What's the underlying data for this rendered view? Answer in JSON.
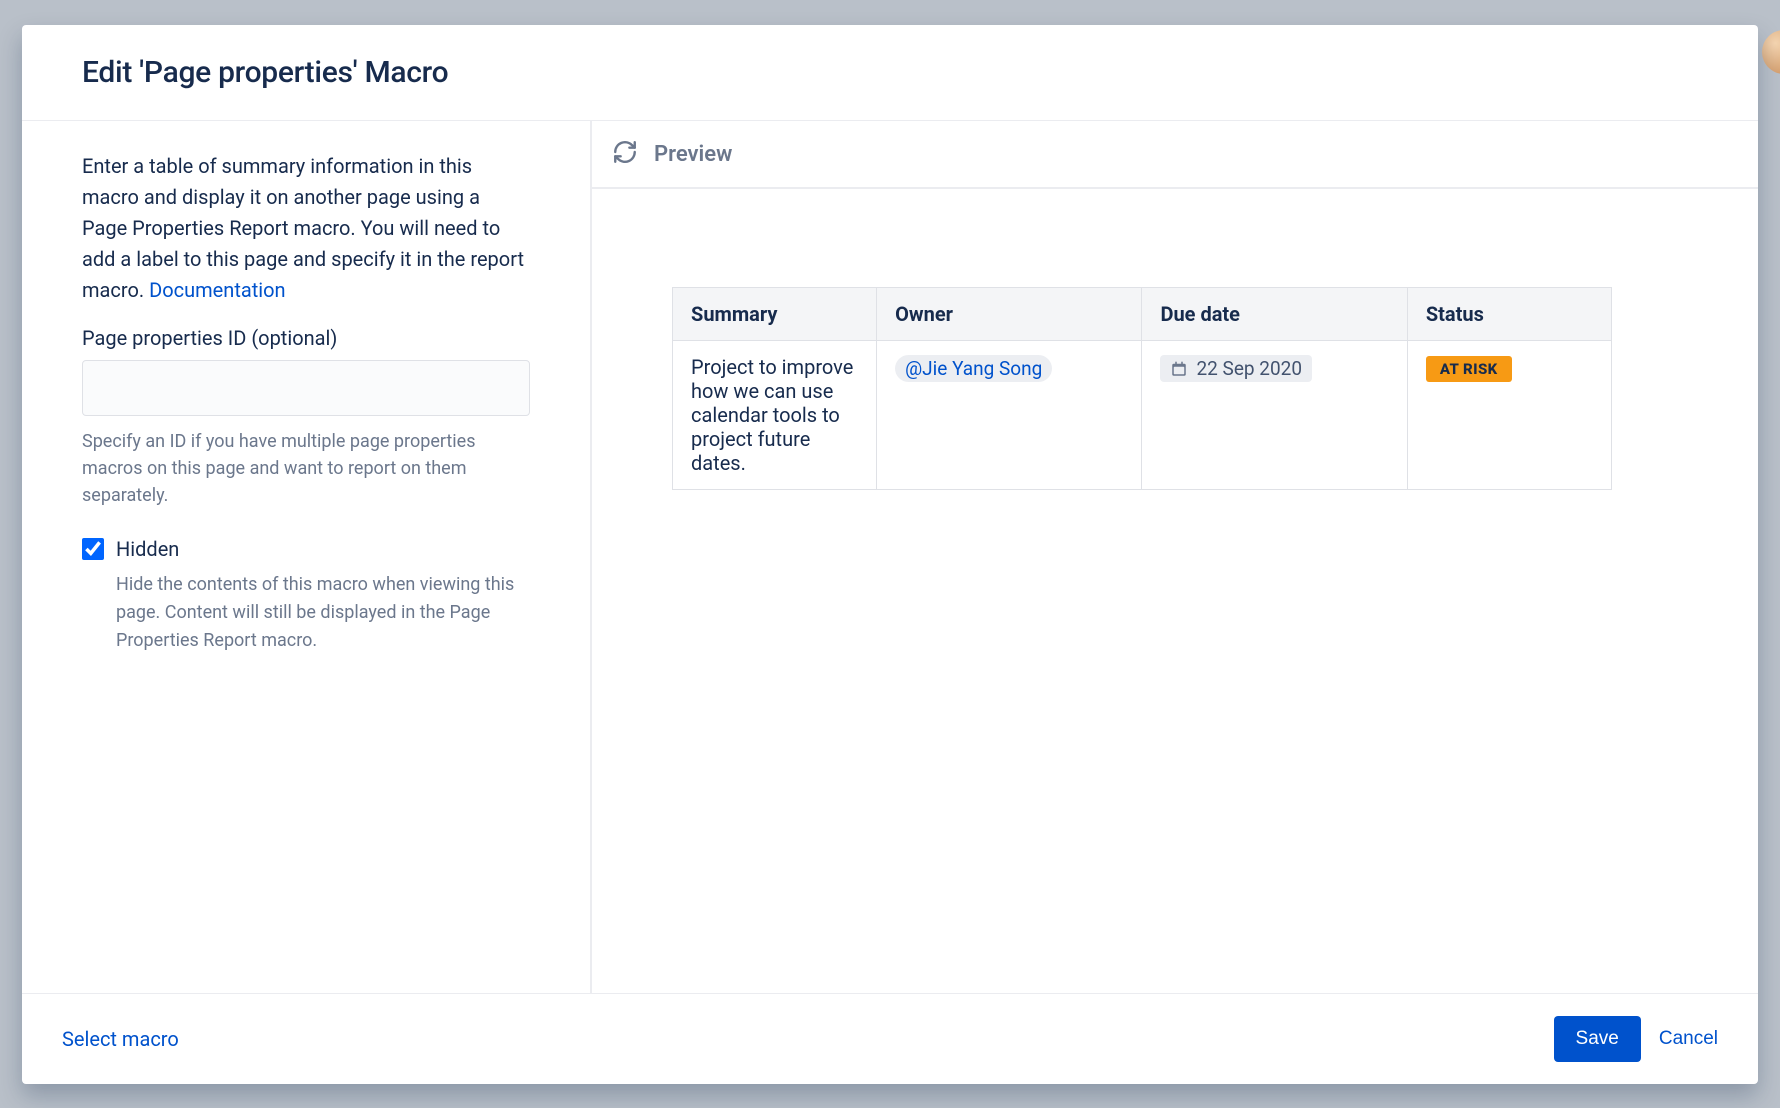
{
  "modal": {
    "title": "Edit 'Page properties' Macro",
    "description_prefix": "Enter a table of summary information in this macro and display it on another page using a Page Properties Report macro. You will need to add a label to this page and specify it in the report macro. ",
    "documentation_link_label": "Documentation",
    "field_id_label": "Page properties ID (optional)",
    "field_id_value": "",
    "field_id_help": "Specify an ID if you have multiple page properties macros on this page and want to report on them separately.",
    "hidden_label": "Hidden",
    "hidden_checked": true,
    "hidden_help": "Hide the contents of this macro when viewing this page. Content will still be displayed in the Page Properties Report macro."
  },
  "preview": {
    "title": "Preview",
    "table": {
      "headers": [
        "Summary",
        "Owner",
        "Due date",
        "Status"
      ],
      "row": {
        "summary": "Project to improve how we can use calendar tools to project future dates.",
        "owner_mention": "@Jie Yang Song",
        "due_date": "22 Sep 2020",
        "status_label": "AT RISK"
      }
    }
  },
  "footer": {
    "select_macro_label": "Select macro",
    "save_label": "Save",
    "cancel_label": "Cancel"
  },
  "colors": {
    "link": "#0052CC",
    "primary": "#0052CC",
    "status_bg": "#F79A14",
    "text": "#172B4D",
    "muted": "#6B778C"
  }
}
